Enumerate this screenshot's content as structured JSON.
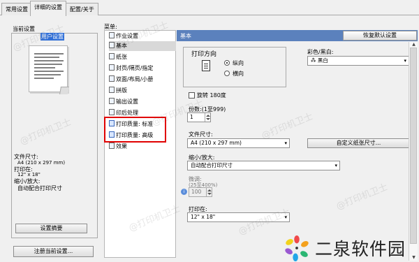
{
  "tabs": [
    "常用设置",
    "详细的设置",
    "配置/关于"
  ],
  "left": {
    "current_settings": "当前设置",
    "user_settings": "用户设置",
    "file_size_label": "文件尺寸:",
    "file_size_value": "A4 (210 x 297 mm)",
    "print_on_label": "打印在:",
    "print_on_value": "12\" x 18\"",
    "scale_label": "缩小/放大:",
    "scale_value": "自动配合打印尺寸",
    "summary_button": "设置摘要",
    "register_button": "注册当前设置..."
  },
  "menu": {
    "label": "菜单:",
    "items": [
      "作业设置",
      "基本",
      "纸张",
      "封页/隔页/指定",
      "双面/布局/小册",
      "拼版",
      "输出设置",
      "印后处理",
      "打印质量: 标准",
      "打印质量: 高级",
      "效果"
    ]
  },
  "right": {
    "section_title": "基本",
    "restore_defaults": "恢复默认设置",
    "orientation_title": "打印方向",
    "orientation_portrait": "纵向",
    "orientation_landscape": "横向",
    "color_label": "彩色/黑白:",
    "color_value": "黑白",
    "rotate_label": "旋转 180度",
    "copies_label": "份数:(1至999)",
    "copies_value": "1",
    "file_size_label": "文件尺寸:",
    "file_size_value": "A4 (210 x 297 mm)",
    "custom_size_button": "自定义纸张尺寸...",
    "scale_label": "缩小/放大:",
    "scale_value": "自动配合打印尺寸",
    "fine_tune_label": "微调:",
    "fine_tune_range": "(25至400%)",
    "fine_tune_value": "100",
    "print_on_label": "打印在:",
    "print_on_value": "12\" x 18\""
  },
  "watermarks": [
    "@打印机卫士"
  ],
  "brand": "二泉软件园",
  "icons": {
    "portrait_icon": "portrait-page-icon",
    "color_icon": "color-mode-icon",
    "info_icon": "info-icon",
    "logo_icon": "pinwheel-logo-icon"
  },
  "colors": {
    "header_blue": "#5b81bd",
    "selection": "#3170d8",
    "annotation_red": "#e00000"
  }
}
